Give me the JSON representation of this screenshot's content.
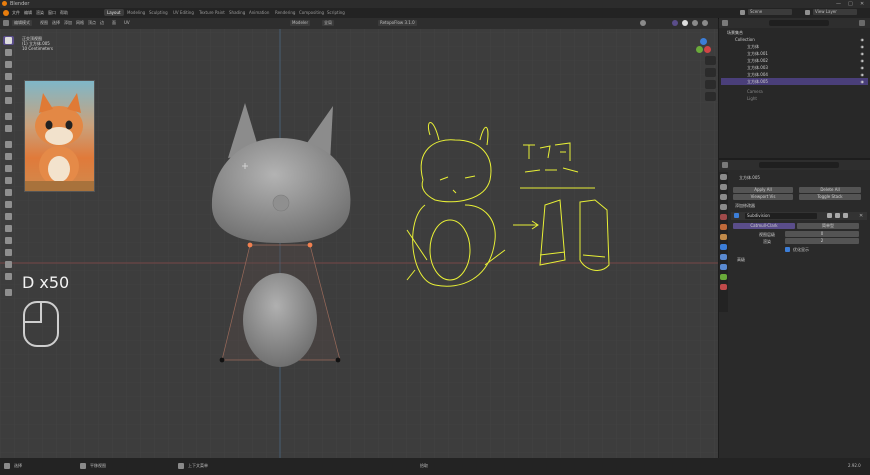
{
  "window": {
    "title": "Blender",
    "controls": [
      "—",
      "□",
      "✕"
    ]
  },
  "menu": [
    "文件",
    "编辑",
    "渲染",
    "窗口",
    "帮助"
  ],
  "workspace_tabs": [
    "Layout",
    "Modeling",
    "Sculpting",
    "UV Editing",
    "Texture Paint",
    "Shading",
    "Animation",
    "Rendering",
    "Compositing",
    "Scripting"
  ],
  "active_workspace": "Layout",
  "scene": {
    "label": "Scene",
    "view_layer": "View Layer"
  },
  "viewport": {
    "mode": "编辑模式",
    "header_items": [
      "视图",
      "选择",
      "添加",
      "网格",
      "顶点",
      "边",
      "面",
      "UV"
    ],
    "transform": "全局",
    "snap_menu": "Modeler",
    "addon": "RetopoFlow 3.1.0",
    "info_lines": [
      "正交顶视图",
      "(1) 立方体.005",
      "10 Centimeters"
    ],
    "key_label": "D x50",
    "tools": [
      "select",
      "cursor",
      "move",
      "rotate",
      "scale",
      "transform",
      "annotate",
      "measure",
      "add-cube",
      "extrude",
      "inset",
      "bevel",
      "loop-cut",
      "knife",
      "poly-build",
      "spin",
      "smooth",
      "edge-slide",
      "shrink",
      "shear",
      "rip"
    ]
  },
  "outliner": {
    "title": "场景集合",
    "rows": [
      {
        "name": "Collection",
        "selected": false
      },
      {
        "name": "立方体",
        "selected": false
      },
      {
        "name": "立方体.001",
        "selected": false
      },
      {
        "name": "立方体.002",
        "selected": false
      },
      {
        "name": "立方体.003",
        "selected": false
      },
      {
        "name": "立方体.004",
        "selected": false
      },
      {
        "name": "立方体.005",
        "selected": true
      },
      {
        "name": "Camera",
        "selected": false
      },
      {
        "name": "Light",
        "selected": false
      }
    ]
  },
  "properties": {
    "object": "立方体.005",
    "apply_all": "Apply All",
    "delete_all": "Delete All",
    "viewport_vis": "Viewport Vis",
    "toggle_stack": "Toggle Stack",
    "add_modifier": "添加修改器",
    "modifier_name": "Subdivision",
    "catmull": "Catmull-Clark",
    "simple": "简单型",
    "levels_viewport_label": "视图层级",
    "levels_viewport": "0",
    "render_label": "渲染",
    "render": "2",
    "optimal_display": "优化显示",
    "advanced": "高级"
  },
  "statusbar": {
    "items": [
      "选择",
      "平移视图",
      "上下文菜单"
    ],
    "center": "拾取",
    "version": "2.92.0"
  },
  "colors": {
    "accent": "#5a4d8a",
    "selected_row": "#4a3f7a",
    "sketch": "#e8f036",
    "vertex_active": "#f08050",
    "model": "#9a9a9a"
  }
}
